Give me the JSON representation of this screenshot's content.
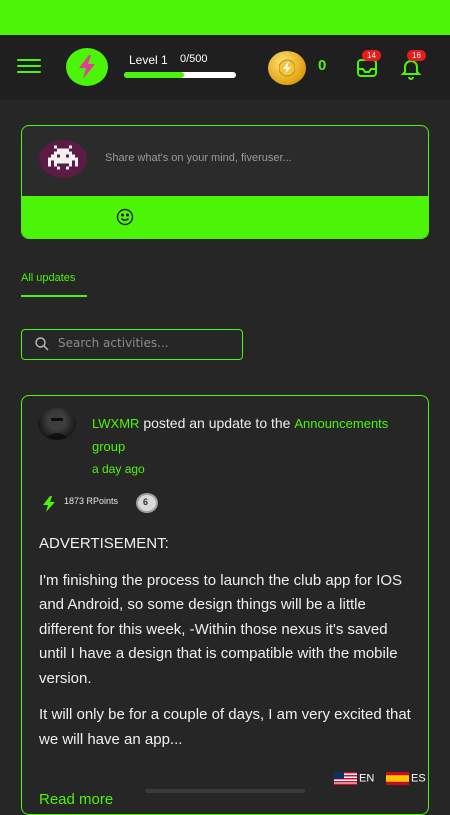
{
  "header": {
    "menu_icon": "hamburger-menu-icon",
    "level_label": "Level 1",
    "level_progress_text": "0/500",
    "level_progress_fraction": 0.54,
    "coin_count": "0",
    "inbox_badge": "14",
    "notifications_badge": "16"
  },
  "composer": {
    "placeholder": "Share what's on your mind, fiveruser...",
    "emoji_icon": "smiley-icon"
  },
  "tabs": [
    {
      "label": "All updates",
      "active": true
    }
  ],
  "search": {
    "placeholder": "Search activities..."
  },
  "post": {
    "author": "LWXMR",
    "action": " posted an update to the ",
    "group": "Announcements group",
    "time": "a day ago",
    "rpoints": "1873 RPoints",
    "rank_badge": "6",
    "paragraphs": [
      "ADVERTISEMENT:",
      "I'm finishing the process to launch the club app for IOS and Android, so some design things will be a little different for this week, -Within those nexus it's saved until I have a design that is compatible with the mobile version.",
      "It will only be for a couple of days, I am very excited that we will have an app..."
    ],
    "read_more": "Read more"
  },
  "languages": [
    {
      "code": "EN"
    },
    {
      "code": "ES"
    }
  ],
  "colors": {
    "accent": "#4cf407",
    "background": "#262626",
    "badge": "#ea1b1b"
  }
}
